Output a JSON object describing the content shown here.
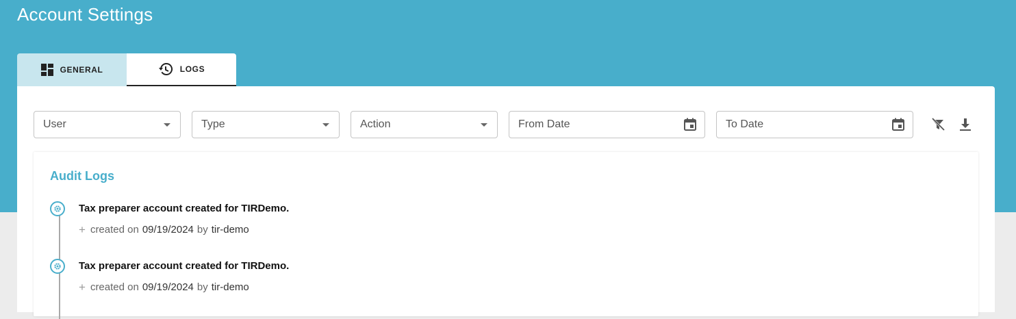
{
  "header": {
    "title": "Account Settings"
  },
  "tabs": [
    {
      "label": "GENERAL",
      "icon": "dashboard-icon",
      "active": false
    },
    {
      "label": "LOGS",
      "icon": "history-icon",
      "active": true
    }
  ],
  "filters": {
    "user": {
      "placeholder": "User"
    },
    "type": {
      "placeholder": "Type"
    },
    "action": {
      "placeholder": "Action"
    },
    "from_date": {
      "placeholder": "From Date",
      "icon": "calendar-icon"
    },
    "to_date": {
      "placeholder": "To Date",
      "icon": "calendar-icon"
    },
    "clear_filter_icon": "filter-off-icon",
    "download_icon": "download-icon"
  },
  "audit": {
    "title": "Audit Logs",
    "entries": [
      {
        "icon": "gear-icon",
        "title": "Tax preparer account created for TIRDemo.",
        "created_label": "created on",
        "date": "09/19/2024",
        "by_label": "by",
        "user": "tir-demo"
      },
      {
        "icon": "gear-icon",
        "title": "Tax preparer account created for TIRDemo.",
        "created_label": "created on",
        "date": "09/19/2024",
        "by_label": "by",
        "user": "tir-demo"
      }
    ]
  },
  "colors": {
    "accent": "#48aecb",
    "tab_inactive": "#c8e6ee"
  }
}
